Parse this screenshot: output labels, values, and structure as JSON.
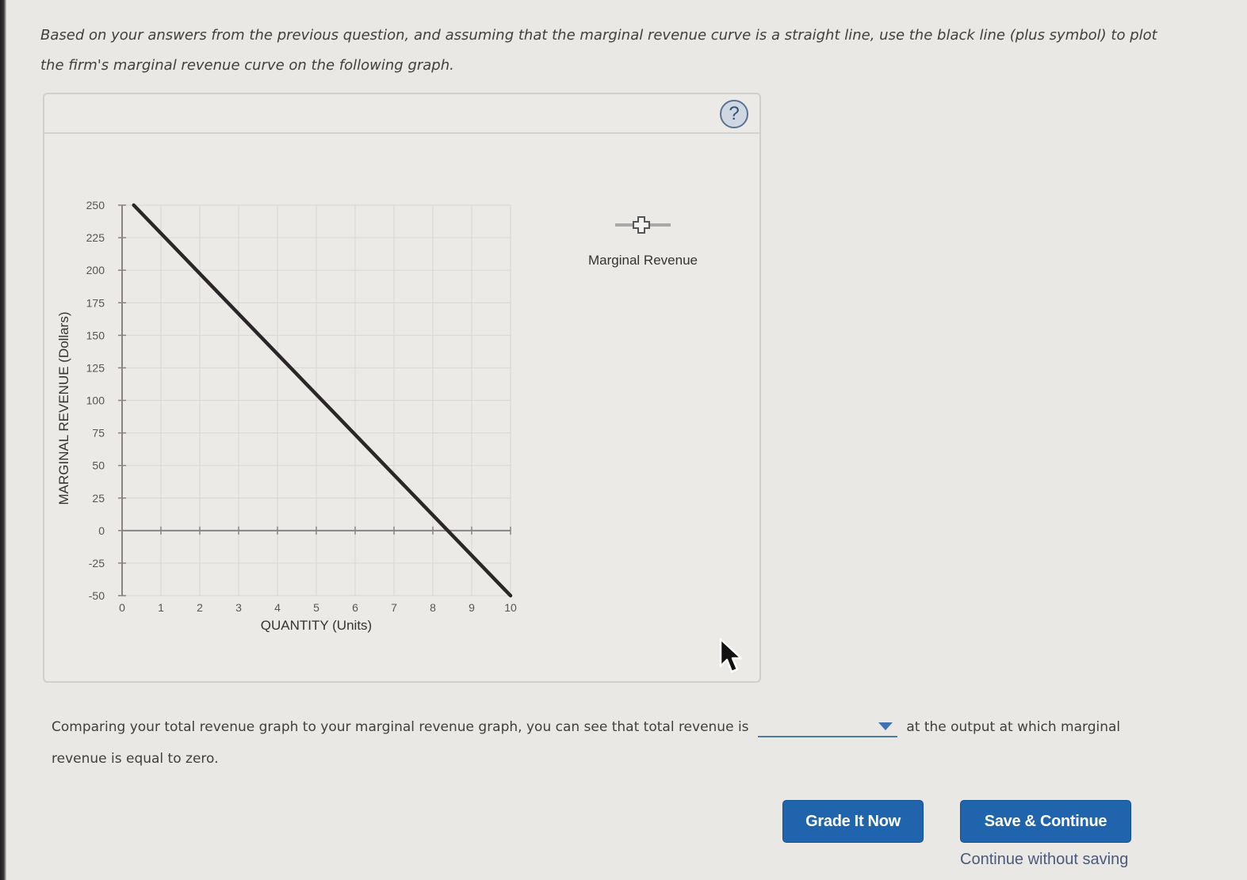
{
  "instructions": "Based on your answers from the previous question, and assuming that the marginal revenue curve is a straight line, use the black line (plus symbol) to plot the firm's marginal revenue curve on the following graph.",
  "graph_panel": {
    "help_icon": "question-circle-icon",
    "help_label": "?",
    "legend": {
      "label": "Marginal Revenue",
      "icon": "plus-marker-icon"
    }
  },
  "chart_data": {
    "type": "line",
    "title": "",
    "xlabel": "QUANTITY (Units)",
    "ylabel": "MARGINAL REVENUE (Dollars)",
    "xlim": [
      0,
      10
    ],
    "ylim": [
      -50,
      250
    ],
    "x_ticks": [
      0,
      1,
      2,
      3,
      4,
      5,
      6,
      7,
      8,
      9,
      10
    ],
    "y_ticks": [
      -50,
      -25,
      0,
      25,
      50,
      75,
      100,
      125,
      150,
      175,
      200,
      225,
      250
    ],
    "grid": true,
    "series": [
      {
        "name": "Marginal Revenue",
        "color": "#2b2628",
        "points": [
          [
            0.3,
            250
          ],
          [
            10,
            -50
          ]
        ]
      }
    ],
    "x_intercept_approx": 8.4
  },
  "question2": {
    "before": "Comparing your total revenue graph to your marginal revenue graph, you can see that total revenue is",
    "dropdown_value": "",
    "after": "at the output at which marginal revenue is equal to zero."
  },
  "buttons": {
    "grade": "Grade It Now",
    "save": "Save & Continue",
    "continue_without_saving": "Continue without saving"
  },
  "colors": {
    "button_blue": "#1f64ad",
    "dropdown_blue": "#3f73b4",
    "link": "#4a5a7a"
  }
}
